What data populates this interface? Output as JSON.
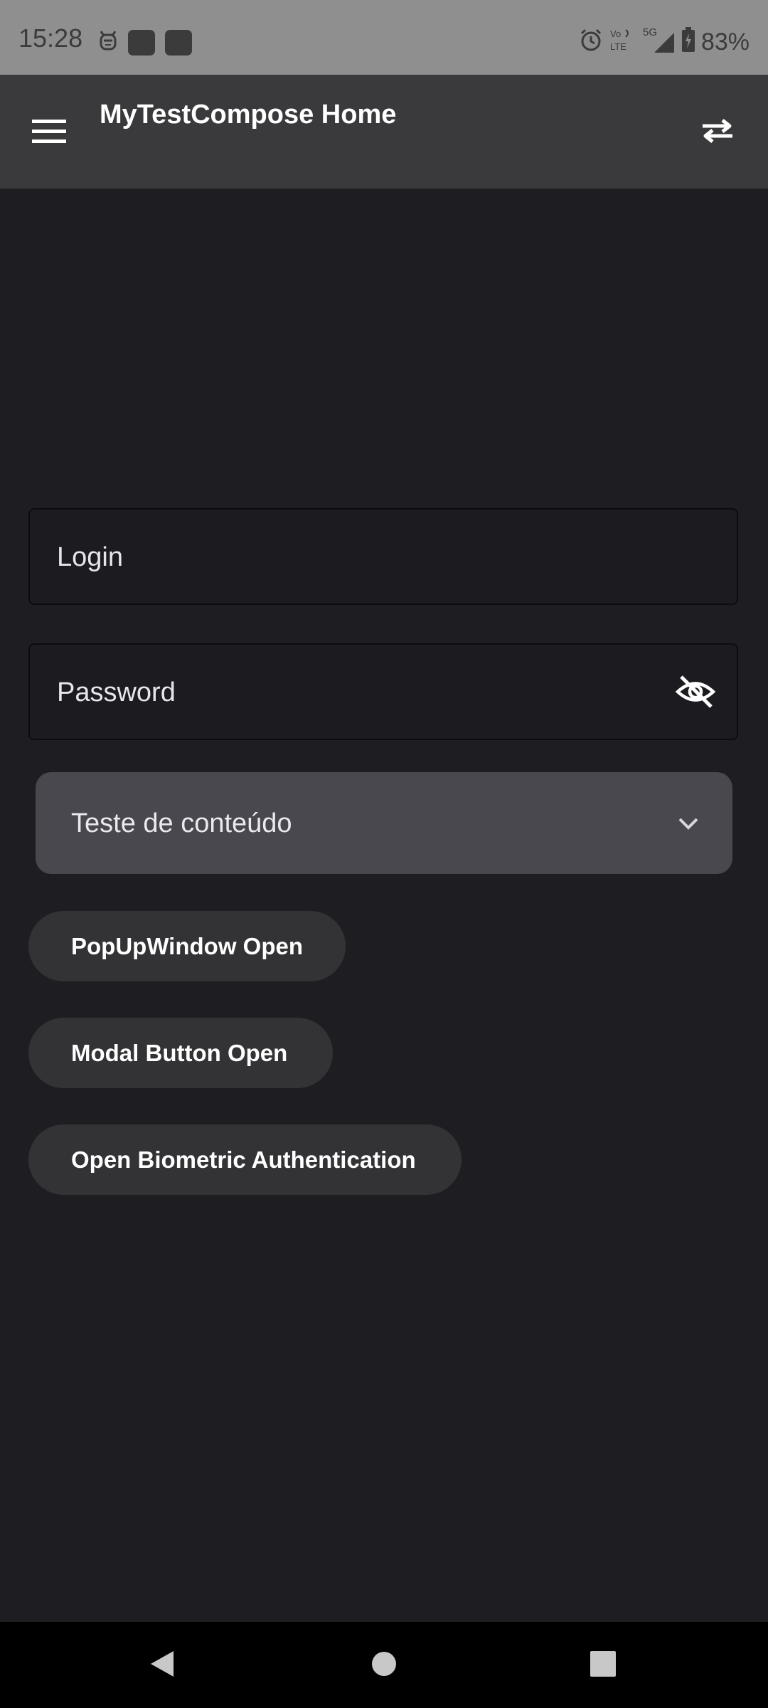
{
  "status_bar": {
    "time": "15:28",
    "battery": "83%",
    "network_vo": "Vo",
    "network_lte": "LTE",
    "network_5g": "5G",
    "icons": [
      "cat-face-icon",
      "app-square-icon",
      "app-square-icon",
      "alarm-icon",
      "volte-icon",
      "signal-icon",
      "battery-charging-icon"
    ]
  },
  "app_bar": {
    "title": "MyTestCompose Home",
    "menu_icon": "hamburger-menu-icon",
    "action_icon": "swap-arrows-icon"
  },
  "form": {
    "login": {
      "label": "Login",
      "value": ""
    },
    "password": {
      "label": "Password",
      "value": "",
      "toggle_icon": "eye-off-icon"
    },
    "dropdown": {
      "selected": "Teste de conteúdo",
      "icon": "chevron-down-icon"
    }
  },
  "buttons": {
    "popup": "PopUpWindow Open",
    "modal": "Modal Button Open",
    "biometric": "Open Biometric Authentication"
  },
  "nav_bar": {
    "back_icon": "back-triangle-icon",
    "home_icon": "home-circle-icon",
    "recents_icon": "recents-square-icon"
  },
  "colors": {
    "status_bar_bg": "#8f8f8f",
    "app_bar_bg": "#3a3a3c",
    "screen_bg": "#1e1e22",
    "dropdown_bg": "#48484e",
    "pill_bg": "#333336",
    "nav_bar_bg": "#000000"
  }
}
